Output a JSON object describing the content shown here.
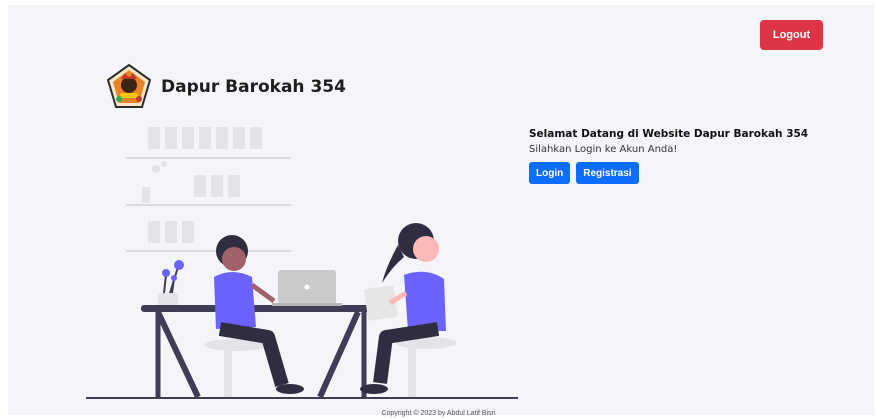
{
  "header": {
    "logout_label": "Logout",
    "brand_name": "Dapur Barokah 354"
  },
  "welcome": {
    "title": "Selamat Datang di Website Dapur Barokah 354",
    "subtitle": "Silahkan Login ke Akun Anda!",
    "login_label": "Login",
    "register_label": "Registrasi"
  },
  "footer": {
    "copyright": "Copyright © 2023 by Abdul Latif Bisri"
  },
  "colors": {
    "logout_red": "#dc3545",
    "primary_blue": "#0d6efd",
    "accent_purple": "#6c63ff",
    "background": "#f4f5f8"
  },
  "icons": {
    "brand_logo": "brand-logo-icon"
  }
}
